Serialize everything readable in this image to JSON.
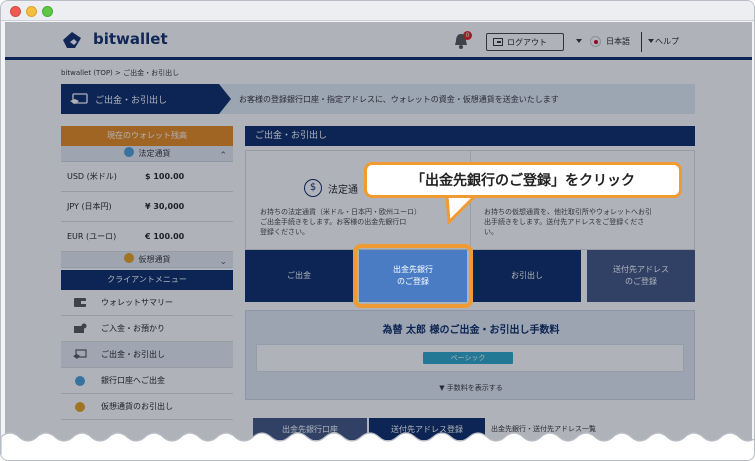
{
  "header": {
    "logo": "bitwallet",
    "notification_count": "0",
    "logout": "ログアウト",
    "language": "日本語",
    "help": "ヘルプ"
  },
  "breadcrumb": "bitwallet (TOP)  >  ご出金・お引出し",
  "banner": {
    "label": "ご出金・お引出し",
    "text": "お客様の登録銀行口座・指定アドレスに、ウォレットの資金・仮想通貨を送金いたします"
  },
  "sidebar": {
    "balance_title": "現在のウォレット残高",
    "fiat_title": "法定通貨",
    "balances": [
      {
        "currency": "USD (米ドル)",
        "amount": "$ 100.00"
      },
      {
        "currency": "JPY (日本円)",
        "amount": "¥ 30,000"
      },
      {
        "currency": "EUR (ユーロ)",
        "amount": "€ 100.00"
      }
    ],
    "crypto_title": "仮想通貨",
    "menu_title": "クライアントメニュー",
    "menu": [
      {
        "label": "ウォレットサマリー"
      },
      {
        "label": "ご入金・お預かり"
      },
      {
        "label": "ご出金・お引出し"
      },
      {
        "label": "銀行口座へご出金"
      },
      {
        "label": "仮想通貨のお引出し"
      }
    ]
  },
  "main": {
    "title": "ご出金・お引出し",
    "fiat_card_title": "法定通",
    "fiat_card_text": "お持ちの法定通貨（米ドル・日本円・欧州ユーロ）\nご出金手続きをします。お客様の出金先銀行口\n登録ください。",
    "crypto_card_text": "お持ちの仮想通貨を、他社取引所やウォレットへお引\n出手続きをします。送付先アドレスをご登録くださ\nい。",
    "tabs": [
      {
        "label": "ご出金"
      },
      {
        "label": "出金先銀行\nのご登録"
      },
      {
        "label": "お引出し"
      },
      {
        "label": "送付先アドレス\nのご登録"
      }
    ],
    "fee_title": "為替 太郎 様のご出金・お引出し手数料",
    "fee_pill": "ベーシック",
    "fee_link": "▼ 手数料を表示する",
    "bottom_buttons": [
      "出金先銀行口座",
      "送付先アドレス登録",
      "出金先銀行・送付先アドレス一覧"
    ]
  },
  "callout": {
    "text": "「出金先銀行のご登録」をクリック"
  },
  "colors": {
    "navy": "#0a2a66",
    "orange": "#f09a34",
    "accent_blue": "#3e6eb6"
  }
}
